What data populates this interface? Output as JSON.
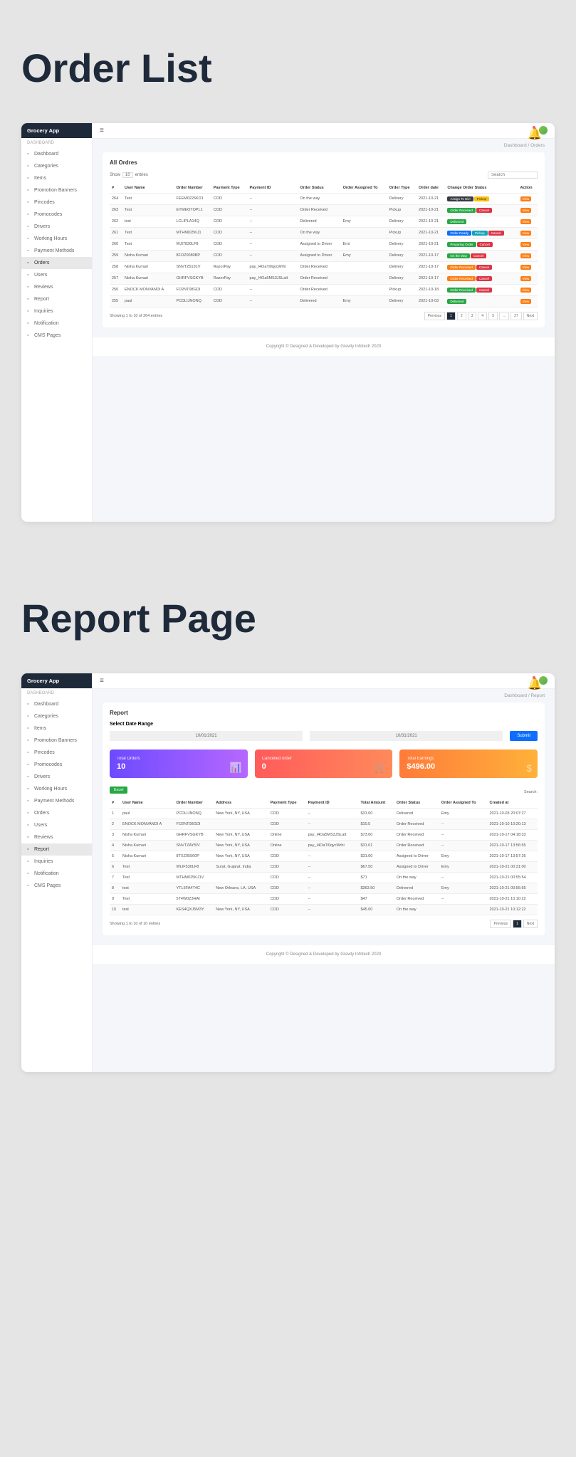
{
  "titles": {
    "order_list": "Order List",
    "report_page": "Report Page"
  },
  "app_name": "Grocery App",
  "sidebar": {
    "section": "DASHBOARD",
    "items": [
      "Dashboard",
      "Categories",
      "Items",
      "Promotion Banners",
      "Pincodes",
      "Promocodes",
      "Drivers",
      "Working Hours",
      "Payment Methods",
      "Orders",
      "Users",
      "Reviews",
      "Report",
      "Inquiries",
      "Notification",
      "CMS Pages"
    ]
  },
  "breadcrumb1": {
    "a": "Dashboard",
    "b": "Orders"
  },
  "breadcrumb2": {
    "a": "Dashboard",
    "b": "Report"
  },
  "orders": {
    "title": "All Ordres",
    "show": "Show",
    "entries_label": "entries",
    "entries_val": "10",
    "search_ph": "Search",
    "headers": [
      "#",
      "User Name",
      "Order Number",
      "Payment Type",
      "Payment ID",
      "Order Status",
      "Order Assigned To",
      "Order Type",
      "Order date",
      "Change Order Status",
      "Action"
    ],
    "rows": [
      {
        "n": "264",
        "user": "Test",
        "ord": "FEEM0226KD1",
        "ptype": "COD",
        "pid": "--",
        "status": "On the way",
        "assigned": "",
        "otype": "Delivery",
        "date": "2021-10-21",
        "badges": [
          [
            "Assign To Divi",
            "dark"
          ],
          [
            "Pickup",
            "yellow"
          ]
        ]
      },
      {
        "n": "263",
        "user": "Test",
        "ord": "EYMEOTOPL1",
        "ptype": "COD",
        "pid": "--",
        "status": "Order Received",
        "assigned": "",
        "otype": "Pickup",
        "date": "2021-10-21",
        "badges": [
          [
            "Order Received",
            "green"
          ],
          [
            "Cancel",
            "red"
          ]
        ]
      },
      {
        "n": "262",
        "user": "test",
        "ord": "LCLIPLA14Q",
        "ptype": "COD",
        "pid": "--",
        "status": "Delivered",
        "assigned": "Emy",
        "otype": "Delivery",
        "date": "2021-10-21",
        "badges": [
          [
            "Delivered",
            "green"
          ]
        ]
      },
      {
        "n": "261",
        "user": "Test",
        "ord": "MTHM025KJ1",
        "ptype": "COD",
        "pid": "--",
        "status": "On the way",
        "assigned": "",
        "otype": "Pickup",
        "date": "2021-10-21",
        "badges": [
          [
            "Order Ready",
            "blue"
          ],
          [
            "Pickup",
            "info"
          ],
          [
            "Cancel",
            "red"
          ]
        ]
      },
      {
        "n": "260",
        "user": "Test",
        "ord": "WJI7830LF8",
        "ptype": "COD",
        "pid": "--",
        "status": "Assigned to Driver",
        "assigned": "Emi",
        "otype": "Delivery",
        "date": "2021-10-21",
        "badges": [
          [
            "Preparing Order",
            "green"
          ],
          [
            "Cancel",
            "red"
          ]
        ]
      },
      {
        "n": "259",
        "user": "Nisha Kumari",
        "ord": "8FOZ0080BP",
        "ptype": "COD",
        "pid": "--",
        "status": "Assigned to Driver",
        "assigned": "Emy",
        "otype": "Delivery",
        "date": "2021-10-17",
        "badges": [
          [
            "On the Way",
            "green"
          ],
          [
            "Cancel",
            "red"
          ]
        ]
      },
      {
        "n": "258",
        "user": "Nisha Kumari",
        "ord": "SNVTZ5191V",
        "ptype": "RazorPay",
        "pid": "pay_I4OaTi0qycWrhi",
        "status": "Order Received",
        "assigned": "",
        "otype": "Delivery",
        "date": "2021-10-17",
        "badges": [
          [
            "Order Received",
            "orange"
          ],
          [
            "Cancel",
            "red"
          ]
        ]
      },
      {
        "n": "257",
        "user": "Nisha Kumari",
        "ord": "GHRFVSGKYB",
        "ptype": "RazorPay",
        "pid": "pay_I4Oa5MS3JSLaIt",
        "status": "Order Received",
        "assigned": "",
        "otype": "Delivery",
        "date": "2021-10-17",
        "badges": [
          [
            "Order Received",
            "orange"
          ],
          [
            "Cancel",
            "red"
          ]
        ]
      },
      {
        "n": "256",
        "user": "ENOCK MONVANDI A",
        "ord": "FO2NT08GDI",
        "ptype": "COD",
        "pid": "--",
        "status": "Order Received",
        "assigned": "",
        "otype": "Pickup",
        "date": "2021-10-18",
        "badges": [
          [
            "Order Received",
            "green"
          ],
          [
            "Cancel",
            "red"
          ]
        ]
      },
      {
        "n": "255",
        "user": "paul",
        "ord": "PCDLIJNONQ",
        "ptype": "COD",
        "pid": "--",
        "status": "Delivered",
        "assigned": "Emy",
        "otype": "Delivery",
        "date": "2021-10-03",
        "badges": [
          [
            "Delivered",
            "green"
          ]
        ]
      }
    ],
    "pagination_info": "Showing 1 to 10 of 264 entries",
    "prev": "Previous",
    "next": "Next",
    "pages": [
      "1",
      "2",
      "3",
      "4",
      "5",
      "...",
      "27"
    ],
    "action": "View"
  },
  "report": {
    "title": "Report",
    "subtitle": "Select Date Range",
    "date_from": "10/01/2021",
    "date_to": "10/31/2021",
    "submit": "Submit",
    "cards": [
      {
        "label": "Total Orders",
        "value": "10",
        "cls": "sc-purple",
        "ic": "📊"
      },
      {
        "label": "Cancelled order",
        "value": "0",
        "cls": "sc-red",
        "ic": "🛒"
      },
      {
        "label": "Total Earnings",
        "value": "$496.00",
        "cls": "sc-orange",
        "ic": "$"
      }
    ],
    "excel": "Excel",
    "search_ph": "Search:",
    "headers": [
      "#",
      "User Name",
      "Order Number",
      "Address",
      "Payment Type",
      "Payment ID",
      "Total Amount",
      "Order Status",
      "Order Assigned To",
      "Created at"
    ],
    "rows": [
      {
        "n": "1",
        "user": "paul",
        "ord": "PCDLIJNONQ",
        "addr": "New York, NY, USA",
        "ptype": "COD",
        "pid": "--",
        "amt": "$31.00",
        "status": "Delivered",
        "assigned": "Emy",
        "date": "2021-10-03 20:07:27"
      },
      {
        "n": "2",
        "user": "ENOCK MONVANDI A",
        "ord": "FO2NT08GDI",
        "addr": "",
        "ptype": "COD",
        "pid": "--",
        "amt": "$10.5",
        "status": "Order Received",
        "assigned": "--",
        "date": "2021-10-10 10:20:13"
      },
      {
        "n": "3",
        "user": "Nisha Kumari",
        "ord": "GHRFVSGKYB",
        "addr": "New York, NY, USA",
        "ptype": "Online",
        "pid": "pay_I4Oa5MS3JSLaIt",
        "amt": "$73.00",
        "status": "Order Received",
        "assigned": "--",
        "date": "2021-10-17 04:18:33"
      },
      {
        "n": "4",
        "user": "Nisha Kumari",
        "ord": "SNVTZAY5IV",
        "addr": "New York, NY, USA",
        "ptype": "Online",
        "pid": "pay_I4OaTi0qycWrhi",
        "amt": "$31.01",
        "status": "Order Received",
        "assigned": "--",
        "date": "2021-10-17 13:56:55"
      },
      {
        "n": "5",
        "user": "Nisha Kumari",
        "ord": "8TXZ05560P",
        "addr": "New York, NY, USA",
        "ptype": "COD",
        "pid": "--",
        "amt": "$31.00",
        "status": "Assigned to Driver",
        "assigned": "Emy",
        "date": "2021-10-17 13:57:26"
      },
      {
        "n": "6",
        "user": "Test",
        "ord": "WLIF530LF8",
        "addr": "Surat, Gujarat, India",
        "ptype": "COD",
        "pid": "--",
        "amt": "$67.50",
        "status": "Assigned to Driver",
        "assigned": "Emy",
        "date": "2021-10-21 00:31:00"
      },
      {
        "n": "7",
        "user": "Test",
        "ord": "MTHM025KJ1V",
        "addr": "",
        "ptype": "COD",
        "pid": "--",
        "amt": "$71",
        "status": "On the way",
        "assigned": "--",
        "date": "2021-10-21 00:55:54"
      },
      {
        "n": "8",
        "user": "test",
        "ord": "YTL5FA4T4C",
        "addr": "New Orleans, LA, USA",
        "ptype": "COD",
        "pid": "--",
        "amt": "$363.50",
        "status": "Delivered",
        "assigned": "Emy",
        "date": "2021-10-21 00:55:55"
      },
      {
        "n": "9",
        "user": "Test",
        "ord": "5T4W0Z3HAI",
        "addr": "",
        "ptype": "COD",
        "pid": "--",
        "amt": "$47",
        "status": "Order Received",
        "assigned": "--",
        "date": "2021-10-21 10:10:22"
      },
      {
        "n": "10",
        "user": "test",
        "ord": "KES4QXJ5M3Y",
        "addr": "New York, NY, USA",
        "ptype": "COD",
        "pid": "--",
        "amt": "$45.00",
        "status": "On the way",
        "assigned": "",
        "date": "2021-10-21 10:12:22"
      }
    ],
    "pagination_info": "Showing 1 to 10 of 10 entries",
    "prev": "Previous",
    "next": "Next"
  },
  "footer": {
    "text": "Copyright © Designed & Developed by Gravity Infotech 2020"
  }
}
